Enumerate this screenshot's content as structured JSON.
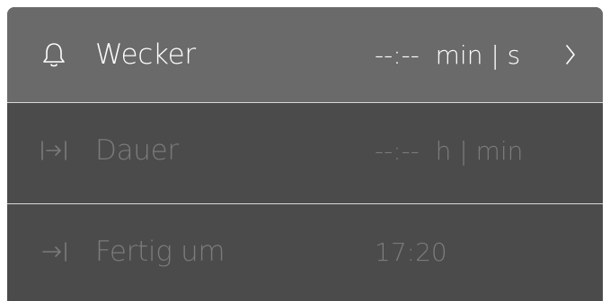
{
  "rows": [
    {
      "label": "Wecker",
      "value": "--:--  min | s",
      "icon": "bell-icon",
      "state": "active"
    },
    {
      "label": "Dauer",
      "value": "--:--  h | min",
      "icon": "duration-icon",
      "state": "disabled"
    },
    {
      "label": "Fertig um",
      "value": "17:20",
      "icon": "end-time-icon",
      "state": "disabled"
    }
  ],
  "colors": {
    "active_row": "#6a6a6a",
    "panel": "#4b4b4b",
    "text_active": "#ffffff",
    "text_disabled": "#7b7b7b",
    "divider": "#d8d8d8"
  }
}
